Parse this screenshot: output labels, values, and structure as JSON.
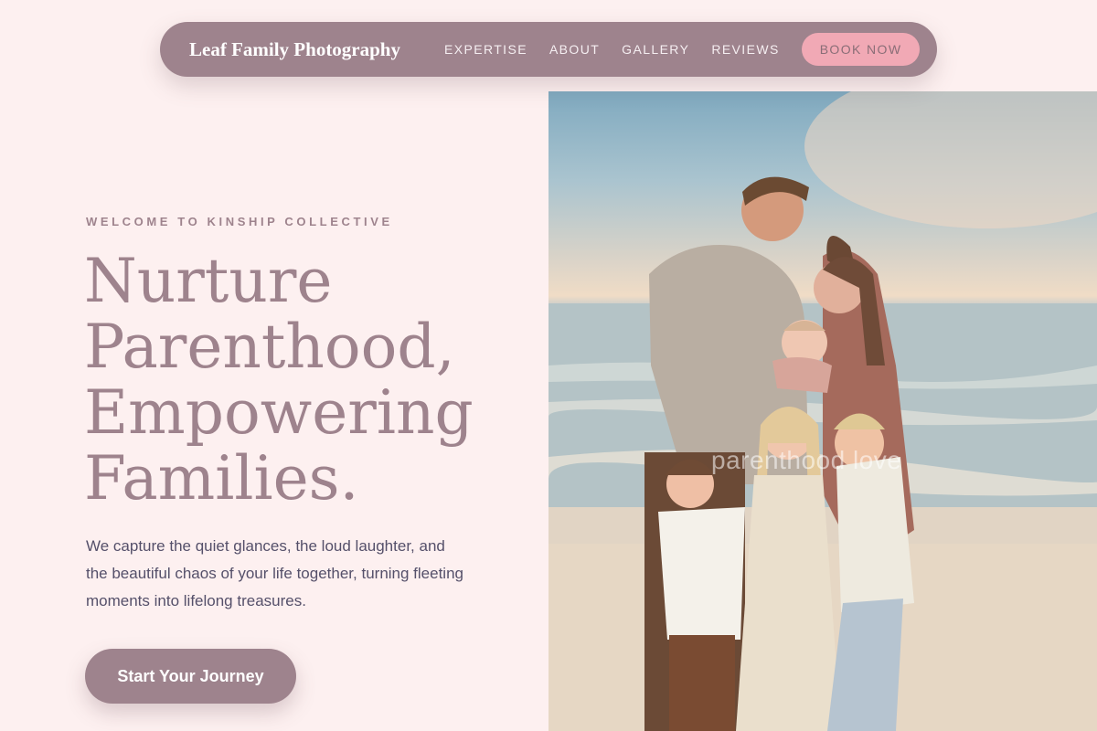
{
  "nav": {
    "brand": "Leaf Family Photography",
    "links": [
      "EXPERTISE",
      "ABOUT",
      "GALLERY",
      "REVIEWS"
    ],
    "cta": "BOOK NOW"
  },
  "hero": {
    "eyebrow": "WELCOME TO KINSHIP COLLECTIVE",
    "headline_lines": [
      "Nurture",
      "Parenthood,",
      "Empowering",
      "Families."
    ],
    "lede": "We capture the quiet glances, the loud laughter, and the beautiful chaos of your life together, turning fleeting moments into lifelong treasures.",
    "cta": "Start Your Journey"
  },
  "photo": {
    "watermark": "parenthood love"
  },
  "colors": {
    "background": "#fdf0f0",
    "primary": "#9e838d",
    "accent_pink": "#f1a9b5",
    "body_text": "#55506a"
  }
}
